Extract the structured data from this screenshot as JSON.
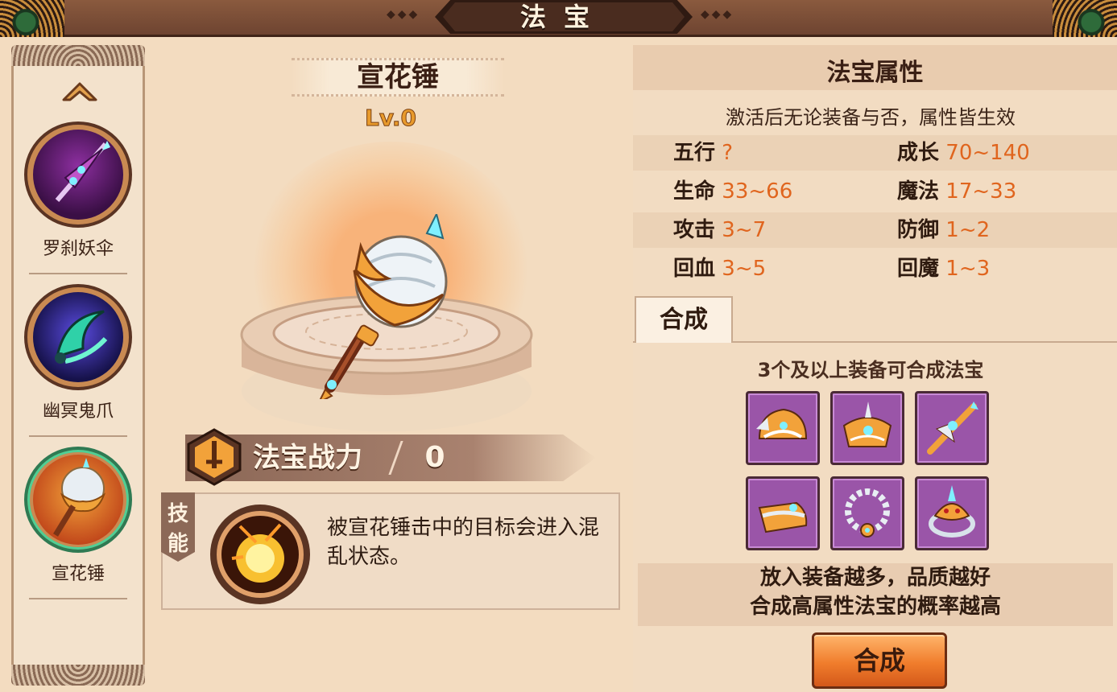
{
  "header": {
    "title": "法宝"
  },
  "sidebar": {
    "items": [
      {
        "label": "罗刹妖伞",
        "icon": "umbrella-weapon-icon",
        "selected": false
      },
      {
        "label": "幽冥鬼爪",
        "icon": "ghost-claw-icon",
        "selected": false
      },
      {
        "label": "宣花锤",
        "icon": "flower-hammer-icon",
        "selected": true
      }
    ]
  },
  "treasure": {
    "name": "宣花锤",
    "level": "Lv.0",
    "power_label": "法宝战力",
    "power_value": "0",
    "skill_tag_1": "技",
    "skill_tag_2": "能",
    "skill_desc": "被宣花锤击中的目标会进入混乱状态。"
  },
  "attributes": {
    "title": "法宝属性",
    "note": "激活后无论装备与否，属性皆生效",
    "rows": [
      {
        "left_key": "五行",
        "left_val": "?",
        "right_key": "成长",
        "right_val": "70~140"
      },
      {
        "left_key": "生命",
        "left_val": "33~66",
        "right_key": "魔法",
        "right_val": "17~33"
      },
      {
        "left_key": "攻击",
        "left_val": "3~7",
        "right_key": "防御",
        "right_val": "1~2"
      },
      {
        "left_key": "回血",
        "left_val": "3~5",
        "right_key": "回魔",
        "right_val": "1~3"
      }
    ]
  },
  "compose": {
    "tab_label": "合成",
    "note": "3个及以上装备可合成法宝",
    "slots": [
      "helmet-icon",
      "crown-icon",
      "weapon-icon",
      "boots-icon",
      "necklace-icon",
      "ring-icon"
    ],
    "hint_1": "放入装备越多，品质越好",
    "hint_2": "合成高属性法宝的概率越高",
    "button_label": "合成"
  },
  "colors": {
    "value_orange": "#e0651e",
    "slot_purple": "#9a55a8",
    "button_orange": "#f07d2c"
  }
}
